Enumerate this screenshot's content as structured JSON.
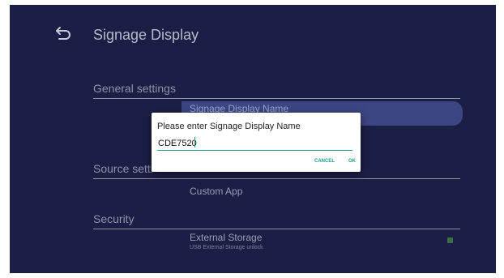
{
  "header": {
    "title": "Signage Display",
    "back_icon": "back-arrow-icon"
  },
  "sections": {
    "general": "General settings",
    "source": "Source setti",
    "security": "Security"
  },
  "items": {
    "signage_name_label": "Signage Display Name",
    "custom_app": "Custom App",
    "external_storage": "External Storage",
    "external_storage_sub": "USB External Storage unlock"
  },
  "dialog": {
    "title": "Please enter Signage Display Name",
    "input_value": "CDE7520",
    "cancel_label": "CANCEL",
    "ok_label": "OK"
  },
  "external_storage_checked": true,
  "colors": {
    "background": "#1c1f45",
    "accent": "#1f9b8f",
    "highlight": "#3d4582"
  }
}
